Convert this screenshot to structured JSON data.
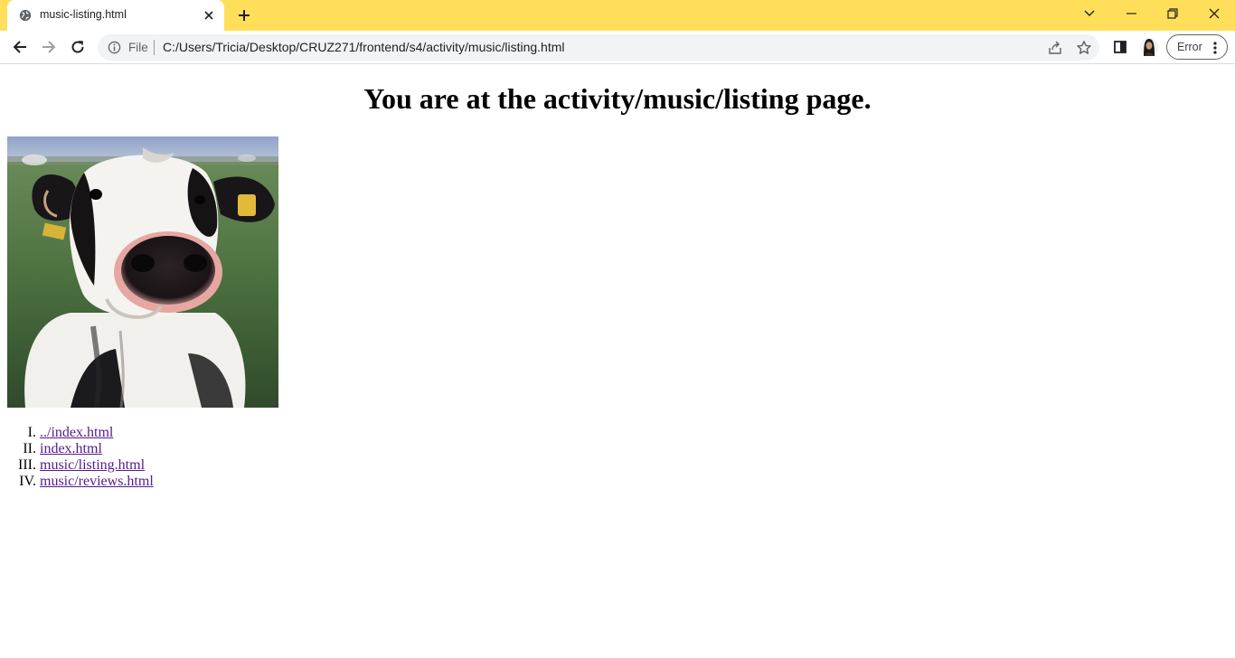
{
  "browser": {
    "tab": {
      "title": "music-listing.html",
      "favicon": "globe-icon"
    },
    "window_controls": [
      "chevron-down-icon",
      "minimize-icon",
      "restore-icon",
      "close-icon"
    ],
    "toolbar": {
      "buttons": [
        "back-arrow-icon",
        "forward-arrow-icon",
        "reload-icon"
      ],
      "omnibox": {
        "scheme_label": "File",
        "url": "C:/Users/Tricia/Desktop/CRUZ271/frontend/s4/activity/music/listing.html",
        "icons": [
          "info-icon",
          "share-icon",
          "star-icon"
        ]
      },
      "side_panel_icon": "side-panel-icon",
      "error_chip_label": "Error"
    },
    "colors": {
      "tabstrip": "#ffdf5a",
      "visited_link": "#551a8b"
    }
  },
  "page": {
    "heading": "You are at the activity/music/listing page.",
    "image": "cow-photo",
    "links": [
      {
        "numeral": "I.",
        "label": "../index.html"
      },
      {
        "numeral": "II.",
        "label": "index.html"
      },
      {
        "numeral": "III.",
        "label": "music/listing.html"
      },
      {
        "numeral": "IV.",
        "label": "music/reviews.html"
      }
    ]
  }
}
